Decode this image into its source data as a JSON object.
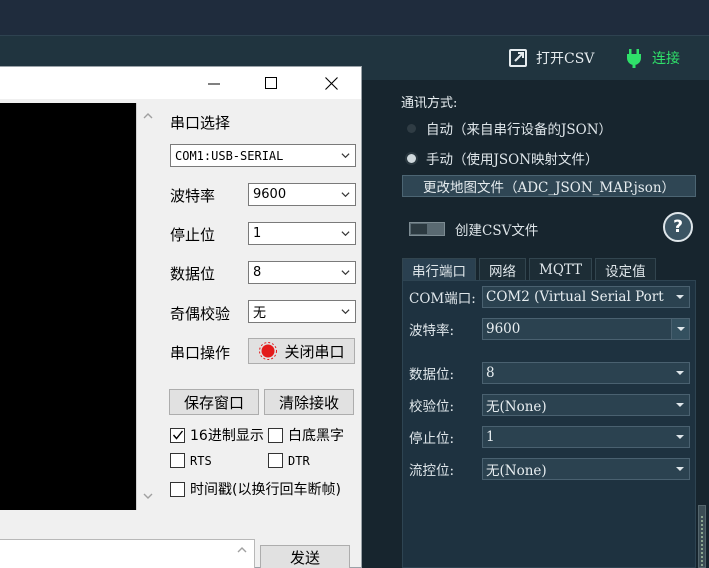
{
  "toolbar": {
    "open_csv_label": "打开CSV",
    "connect_label": "连接"
  },
  "settings": {
    "comm_mode_title": "通讯方式:",
    "mode_auto_label": "自动（来自串行设备的JSON）",
    "mode_manual_label": "手动（使用JSON映射文件）",
    "change_map_label": "更改地图文件（ADC_JSON_MAP.json）",
    "create_csv_label": "创建CSV文件",
    "help_icon": "?",
    "tabs": [
      {
        "label": "串行端口",
        "active": true
      },
      {
        "label": "网络",
        "active": false
      },
      {
        "label": "MQTT",
        "active": false
      },
      {
        "label": "设定值",
        "active": false
      }
    ],
    "fields": {
      "com_port": {
        "label": "COM端口:",
        "value": "COM2 (Virtual Serial Port"
      },
      "baud": {
        "label": "波特率:",
        "value": "9600"
      },
      "data_bits": {
        "label": "数据位:",
        "value": "8"
      },
      "parity": {
        "label": "校验位:",
        "value": "无(None)"
      },
      "stop_bits": {
        "label": "停止位:",
        "value": "1"
      },
      "flow_control": {
        "label": "流控位:",
        "value": "无(None)"
      }
    }
  },
  "serial_window": {
    "port_select_label": "串口选择",
    "port_value": "COM1:USB-SERIAL",
    "baud_label": "波特率",
    "baud_value": "9600",
    "stop_label": "停止位",
    "stop_value": "1",
    "data_label": "数据位",
    "data_value": "8",
    "parity_label": "奇偶校验",
    "parity_value": "无",
    "port_op_label": "串口操作",
    "close_port_label": "关闭串口",
    "save_window_label": "保存窗口",
    "clear_recv_label": "清除接收",
    "hex_display_label": "16进制显示",
    "white_bg_label": "白底黑字",
    "rts_label": "RTS",
    "dtr_label": "DTR",
    "timestamp_label": "时间戳(以换行回车断帧)",
    "send_label": "发送"
  },
  "colors": {
    "connect_green": "#2fe06a",
    "dark_panel": "#1e3240",
    "close_port_red": "#e31b1b"
  }
}
